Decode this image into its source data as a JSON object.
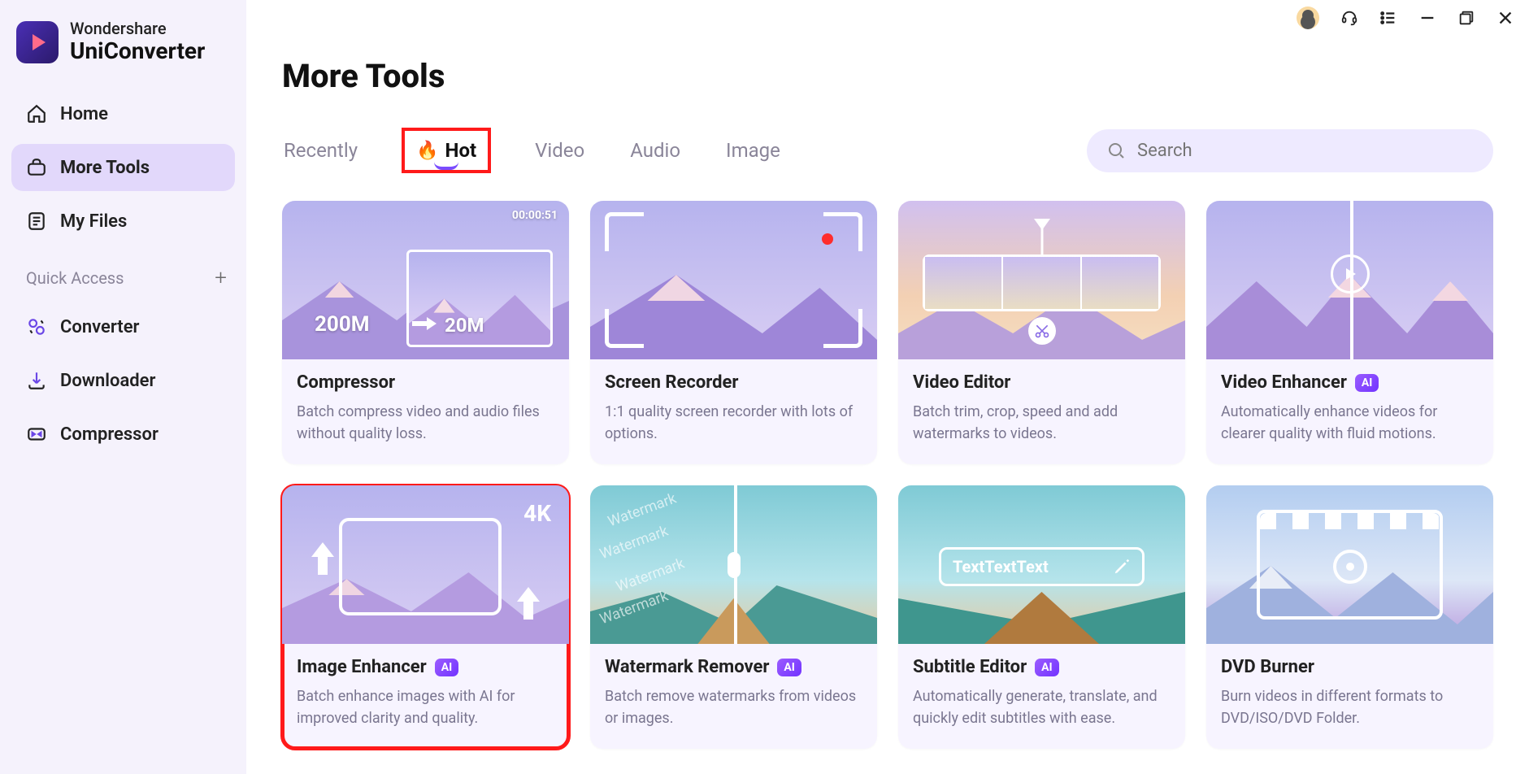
{
  "brand": {
    "line1": "Wondershare",
    "line2": "UniConverter"
  },
  "sidebar": {
    "items": [
      {
        "label": "Home"
      },
      {
        "label": "More Tools"
      },
      {
        "label": "My Files"
      }
    ],
    "quick_access_label": "Quick Access",
    "quick": [
      {
        "label": "Converter"
      },
      {
        "label": "Downloader"
      },
      {
        "label": "Compressor"
      }
    ]
  },
  "page_title": "More Tools",
  "tabs": {
    "recently": "Recently",
    "hot": "Hot",
    "video": "Video",
    "audio": "Audio",
    "image": "Image"
  },
  "search": {
    "placeholder": "Search"
  },
  "cards": [
    {
      "title": "Compressor",
      "desc": "Batch compress video and audio files without quality loss.",
      "ai": false,
      "thumb": {
        "timecode": "00:00:51",
        "size_from": "200M",
        "size_to": "20M"
      }
    },
    {
      "title": "Screen Recorder",
      "desc": "1:1 quality screen recorder with lots of options.",
      "ai": false
    },
    {
      "title": "Video Editor",
      "desc": "Batch trim, crop, speed and add watermarks to videos.",
      "ai": false
    },
    {
      "title": "Video Enhancer",
      "desc": "Automatically enhance videos for clearer quality with fluid motions.",
      "ai": true
    },
    {
      "title": "Image Enhancer",
      "desc": "Batch enhance images with AI for improved clarity and quality.",
      "ai": true,
      "thumb": {
        "fourk": "4K"
      }
    },
    {
      "title": "Watermark Remover",
      "desc": "Batch remove watermarks from videos or images.",
      "ai": true,
      "thumb": {
        "wm": "Watermark"
      }
    },
    {
      "title": "Subtitle Editor",
      "desc": "Automatically generate, translate, and quickly edit subtitles with ease.",
      "ai": true,
      "thumb": {
        "subtitle": "TextTextText"
      }
    },
    {
      "title": "DVD Burner",
      "desc": "Burn videos in different formats to DVD/ISO/DVD Folder.",
      "ai": false
    }
  ],
  "ai_badge": "AI"
}
